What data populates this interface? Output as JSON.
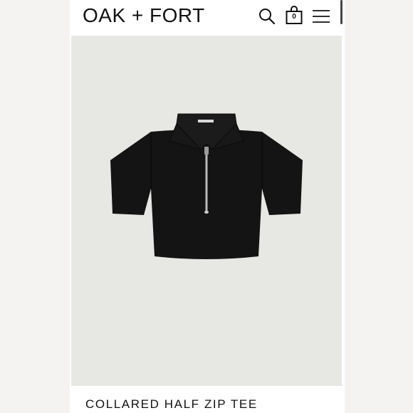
{
  "header": {
    "logo": "OAK + FORT",
    "search_icon": "search-icon",
    "bag_icon": "shopping-bag-icon",
    "bag_count": "0",
    "menu_icon": "hamburger-menu-icon"
  },
  "product": {
    "title": "COLLARED HALF ZIP TEE",
    "image_icon": "black-cropped-half-zip-collared-tee",
    "colors": {
      "background": "#e7e7e4",
      "garment": "#141414",
      "zipper": "#b9b9b9"
    }
  }
}
